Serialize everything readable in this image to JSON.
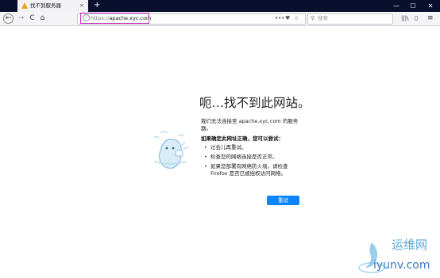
{
  "tab": {
    "title": "找不到服务器",
    "close": "×"
  },
  "new_tab": "+",
  "window_controls": {
    "minimize": "—",
    "maximize": "☐",
    "close": "✕"
  },
  "nav": {
    "back": "←",
    "forward": "→",
    "reload": "C",
    "home": "⌂"
  },
  "urlbar": {
    "scheme": "https://",
    "host": "apache.xyc.com",
    "info": "i",
    "more": "•••",
    "pocket": "♥",
    "bookmark": "☆"
  },
  "search": {
    "placeholder": "搜索",
    "icon": "⚲"
  },
  "toolbar_icons": {
    "library": "|||\\",
    "sidebar": "▯",
    "menu": "≡"
  },
  "error": {
    "title": "呃…找不到此网站。",
    "description": "我们无法连接至 apache.xyc.com 的服务器。",
    "suggest_title": "如果确定此网址正确，您可以尝试：",
    "suggestions": [
      "过会儿再重试。",
      "检查您的网络连接是否正常。",
      "如果您部署有网络防火墙，请检查 Firefox 是否已被授权访问网络。"
    ],
    "retry_button": "重试"
  },
  "watermark": {
    "name": "运维网",
    "url": "iyunv.com"
  },
  "colors": {
    "titlebar": "#0a0f2e",
    "accent": "#0a84ff",
    "highlight": "#c733c7"
  }
}
